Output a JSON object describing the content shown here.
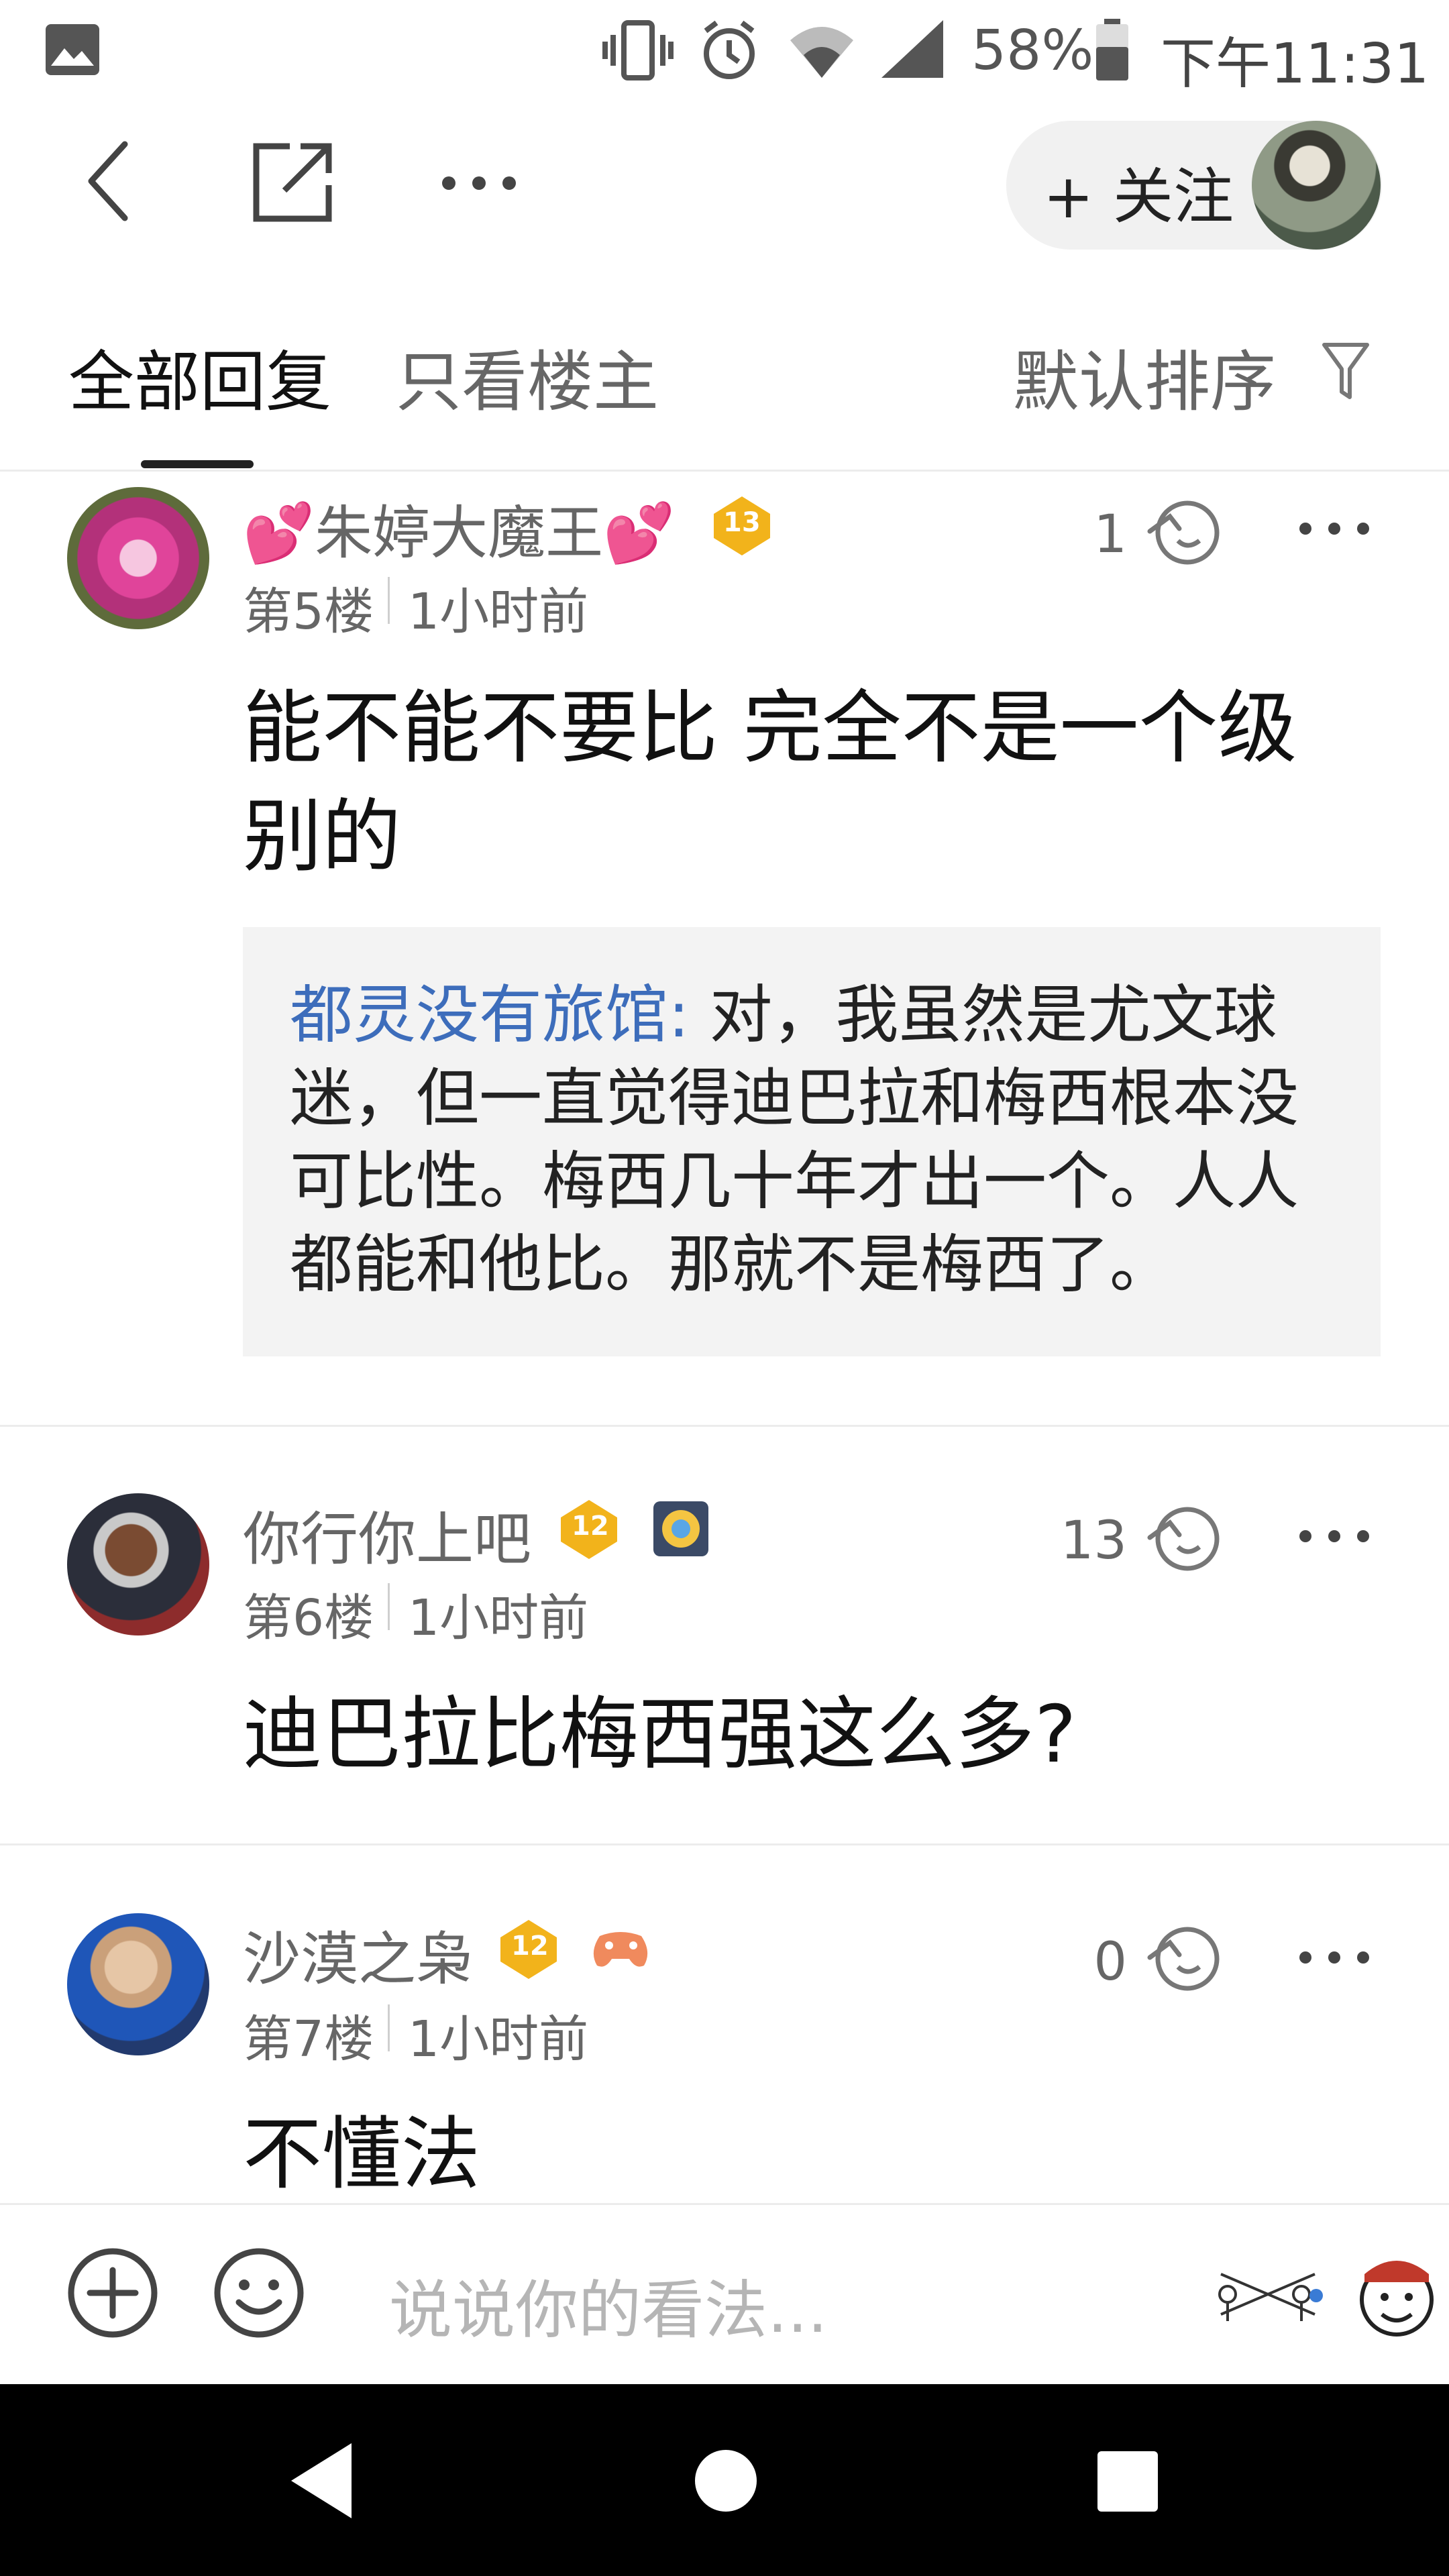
{
  "status_bar": {
    "battery": "58%",
    "time": "下午11:31",
    "icons": [
      "image-icon",
      "vibrate-icon",
      "alarm-icon",
      "wifi-icon",
      "signal-icon",
      "battery-icon"
    ]
  },
  "nav": {
    "icons": [
      "back-icon",
      "share-icon",
      "more-icon"
    ],
    "follow_label": "+ 关注"
  },
  "tabs": {
    "all_replies": "全部回复",
    "only_op": "只看楼主",
    "sort": "默认排序"
  },
  "posts": [
    {
      "username": "💕朱婷大魔王💕",
      "level": "13",
      "floor": "第5楼",
      "time": "1小时前",
      "likes": "1",
      "content": "能不能不要比 完全不是一个级别的",
      "quote": {
        "name": "都灵没有旅馆:",
        "text": " 对，我虽然是尤文球迷，但一直觉得迪巴拉和梅西根本没可比性。梅西几十年才出一个。人人都能和他比。那就不是梅西了。"
      }
    },
    {
      "username": "你行你上吧",
      "level": "12",
      "floor": "第6楼",
      "time": "1小时前",
      "likes": "13",
      "content": "迪巴拉比梅西强这么多?"
    },
    {
      "username": "沙漠之枭",
      "level": "12",
      "floor": "第7楼",
      "time": "1小时前",
      "likes": "0",
      "content": "不懂法"
    }
  ],
  "input": {
    "placeholder": "说说你的看法..."
  },
  "colors": {
    "quote_name": "#3d6dbb",
    "level_badge": "#f2b31b",
    "nav_bar": "#000000"
  }
}
